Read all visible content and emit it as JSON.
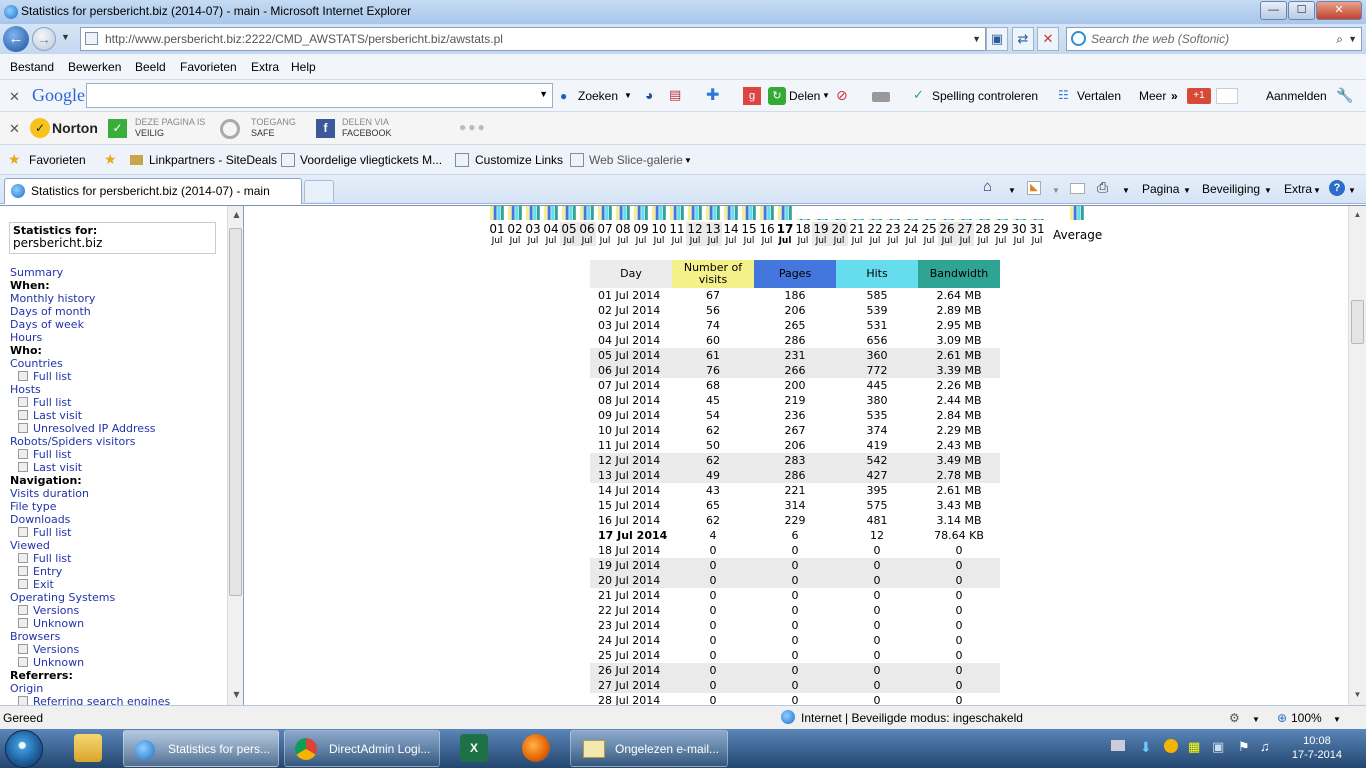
{
  "window": {
    "title": "Statistics for persbericht.biz (2014-07) - main - Microsoft Internet Explorer",
    "min_label": "—",
    "max_label": "☐",
    "close_label": "✕"
  },
  "nav": {
    "url": "http://www.persbericht.biz:2222/CMD_AWSTATS/persbericht.biz/awstats.pl",
    "url_domain": "persbericht.biz",
    "search_placeholder": "Search the web (Softonic)"
  },
  "menubar": [
    "Bestand",
    "Bewerken",
    "Beeld",
    "Favorieten",
    "Extra",
    "Help"
  ],
  "google_bar": {
    "logo": "Google",
    "zoeken": "Zoeken",
    "delen": "Delen",
    "spelling": "Spelling controleren",
    "vertalen": "Vertalen",
    "meer": "Meer",
    "aanmelden": "Aanmelden",
    "gplus": "+1"
  },
  "norton_bar": {
    "logo": "Norton",
    "safe_line1": "DEZE PAGINA IS",
    "safe_line2": "VEILIG",
    "access_line1": "TOEGANG",
    "access_line2": "SAFE",
    "share_line1": "DELEN VIA",
    "share_line2": "FACEBOOK"
  },
  "favorites_bar": {
    "favorieten": "Favorieten",
    "items": [
      "Linkpartners - SiteDeals",
      "Voordelige vliegtickets M...",
      "Customize Links",
      "Web Slice-galerie"
    ]
  },
  "tab": {
    "title": "Statistics for persbericht.biz (2014-07) - main",
    "pagina": "Pagina",
    "beveiliging": "Beveiliging",
    "extra": "Extra"
  },
  "left_menu": {
    "stats_for": "Statistics for:",
    "site": "persbericht.biz",
    "items": [
      {
        "text": "Summary",
        "kind": "link"
      },
      {
        "text": "When:",
        "kind": "hd"
      },
      {
        "text": "Monthly history",
        "kind": "link"
      },
      {
        "text": "Days of month",
        "kind": "link"
      },
      {
        "text": "Days of week",
        "kind": "link"
      },
      {
        "text": "Hours",
        "kind": "link"
      },
      {
        "text": "Who:",
        "kind": "hd"
      },
      {
        "text": "Countries",
        "kind": "link"
      },
      {
        "text": "Full list",
        "kind": "sub"
      },
      {
        "text": "Hosts",
        "kind": "link"
      },
      {
        "text": "Full list",
        "kind": "sub"
      },
      {
        "text": "Last visit",
        "kind": "sub"
      },
      {
        "text": "Unresolved IP Address",
        "kind": "sub"
      },
      {
        "text": "Robots/Spiders visitors",
        "kind": "link"
      },
      {
        "text": "Full list",
        "kind": "sub"
      },
      {
        "text": "Last visit",
        "kind": "sub"
      },
      {
        "text": "Navigation:",
        "kind": "hd"
      },
      {
        "text": "Visits duration",
        "kind": "link"
      },
      {
        "text": "File type",
        "kind": "link"
      },
      {
        "text": "Downloads",
        "kind": "link"
      },
      {
        "text": "Full list",
        "kind": "sub"
      },
      {
        "text": "Viewed",
        "kind": "link"
      },
      {
        "text": "Full list",
        "kind": "sub"
      },
      {
        "text": "Entry",
        "kind": "sub"
      },
      {
        "text": "Exit",
        "kind": "sub"
      },
      {
        "text": "Operating Systems",
        "kind": "link"
      },
      {
        "text": "Versions",
        "kind": "sub"
      },
      {
        "text": "Unknown",
        "kind": "sub"
      },
      {
        "text": "Browsers",
        "kind": "link"
      },
      {
        "text": "Versions",
        "kind": "sub"
      },
      {
        "text": "Unknown",
        "kind": "sub"
      },
      {
        "text": "Referrers:",
        "kind": "hd"
      },
      {
        "text": "Origin",
        "kind": "link"
      },
      {
        "text": "Referring search engines",
        "kind": "sub"
      }
    ]
  },
  "day_axis": {
    "days": [
      "01",
      "02",
      "03",
      "04",
      "05",
      "06",
      "07",
      "08",
      "09",
      "10",
      "11",
      "12",
      "13",
      "14",
      "15",
      "16",
      "17",
      "18",
      "19",
      "20",
      "21",
      "22",
      "23",
      "24",
      "25",
      "26",
      "27",
      "28",
      "29",
      "30",
      "31"
    ],
    "month": "Jul",
    "weekend_days": [
      "05",
      "06",
      "12",
      "13",
      "19",
      "20",
      "26",
      "27"
    ],
    "today": "17",
    "average_label": "Average"
  },
  "colors": {
    "visits": "#f4f08a",
    "pages": "#4477dd",
    "hits": "#66ddee",
    "bandwidth": "#2ea495",
    "weekend_row": "#eaeaea"
  },
  "table": {
    "headers": [
      "Day",
      "Number of visits",
      "Pages",
      "Hits",
      "Bandwidth"
    ],
    "rows": [
      [
        "01 Jul 2014",
        "67",
        "186",
        "585",
        "2.64 MB"
      ],
      [
        "02 Jul 2014",
        "56",
        "206",
        "539",
        "2.89 MB"
      ],
      [
        "03 Jul 2014",
        "74",
        "265",
        "531",
        "2.95 MB"
      ],
      [
        "04 Jul 2014",
        "60",
        "286",
        "656",
        "3.09 MB"
      ],
      [
        "05 Jul 2014",
        "61",
        "231",
        "360",
        "2.61 MB"
      ],
      [
        "06 Jul 2014",
        "76",
        "266",
        "772",
        "3.39 MB"
      ],
      [
        "07 Jul 2014",
        "68",
        "200",
        "445",
        "2.26 MB"
      ],
      [
        "08 Jul 2014",
        "45",
        "219",
        "380",
        "2.44 MB"
      ],
      [
        "09 Jul 2014",
        "54",
        "236",
        "535",
        "2.84 MB"
      ],
      [
        "10 Jul 2014",
        "62",
        "267",
        "374",
        "2.29 MB"
      ],
      [
        "11 Jul 2014",
        "50",
        "206",
        "419",
        "2.43 MB"
      ],
      [
        "12 Jul 2014",
        "62",
        "283",
        "542",
        "3.49 MB"
      ],
      [
        "13 Jul 2014",
        "49",
        "286",
        "427",
        "2.78 MB"
      ],
      [
        "14 Jul 2014",
        "43",
        "221",
        "395",
        "2.61 MB"
      ],
      [
        "15 Jul 2014",
        "65",
        "314",
        "575",
        "3.43 MB"
      ],
      [
        "16 Jul 2014",
        "62",
        "229",
        "481",
        "3.14 MB"
      ],
      [
        "17 Jul 2014",
        "4",
        "6",
        "12",
        "78.64 KB"
      ],
      [
        "18 Jul 2014",
        "0",
        "0",
        "0",
        "0"
      ],
      [
        "19 Jul 2014",
        "0",
        "0",
        "0",
        "0"
      ],
      [
        "20 Jul 2014",
        "0",
        "0",
        "0",
        "0"
      ],
      [
        "21 Jul 2014",
        "0",
        "0",
        "0",
        "0"
      ],
      [
        "22 Jul 2014",
        "0",
        "0",
        "0",
        "0"
      ],
      [
        "23 Jul 2014",
        "0",
        "0",
        "0",
        "0"
      ],
      [
        "24 Jul 2014",
        "0",
        "0",
        "0",
        "0"
      ],
      [
        "25 Jul 2014",
        "0",
        "0",
        "0",
        "0"
      ],
      [
        "26 Jul 2014",
        "0",
        "0",
        "0",
        "0"
      ],
      [
        "27 Jul 2014",
        "0",
        "0",
        "0",
        "0"
      ],
      [
        "28 Jul 2014",
        "0",
        "0",
        "0",
        "0"
      ]
    ]
  },
  "statusbar": {
    "left": "Gereed",
    "zone": "Internet | Beveiligde modus: ingeschakeld",
    "zoom": "100%"
  },
  "taskbar": {
    "tasks": [
      "Statistics for pers...",
      "DirectAdmin Logi...",
      "Ongelezen e-mail..."
    ],
    "time": "10:08",
    "date": "17-7-2014"
  }
}
